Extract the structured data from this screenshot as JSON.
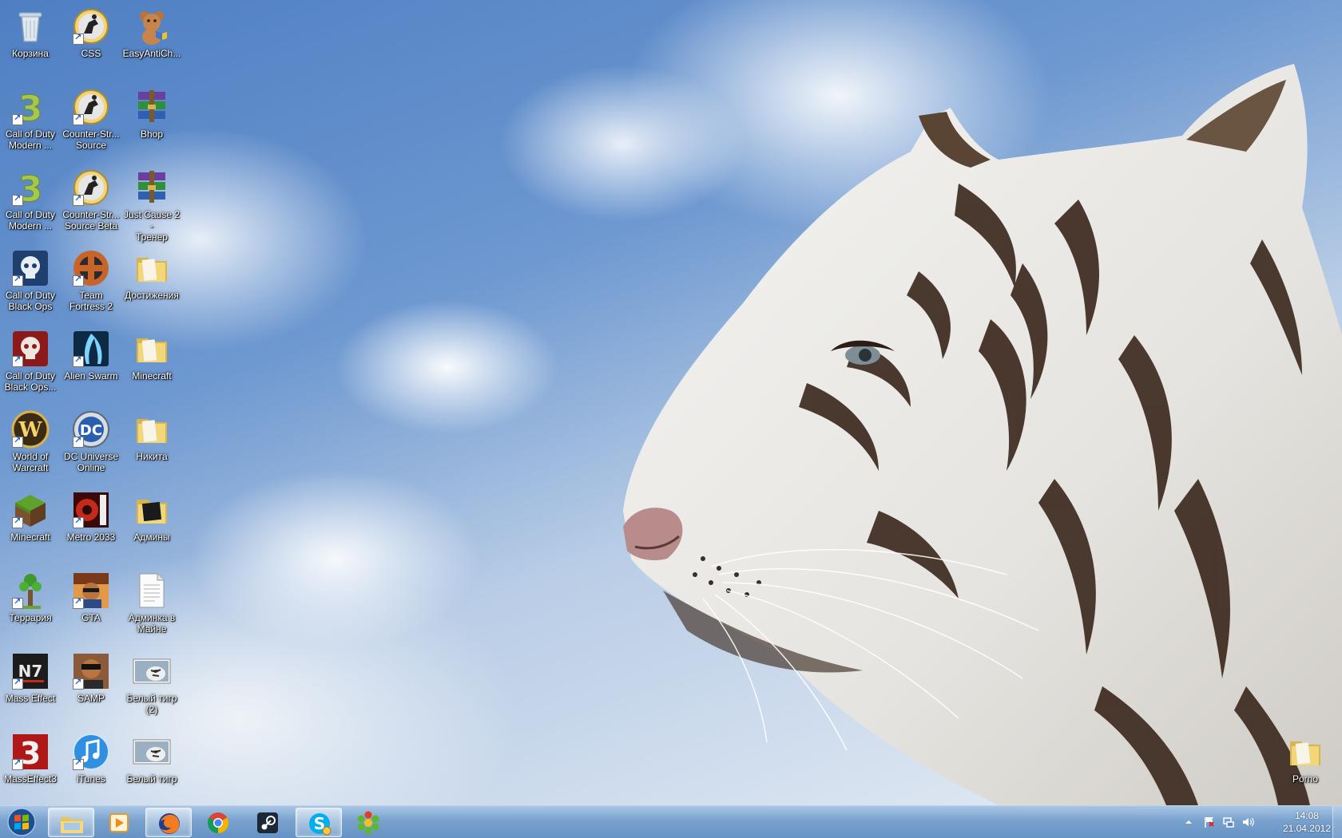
{
  "desktop": {
    "icons": [
      {
        "label": "Корзина",
        "icon": "recycle-bin-icon"
      },
      {
        "label": "CSS",
        "icon": "counter-strike-icon"
      },
      {
        "label": "EasyAntiCh...",
        "icon": "teddy-bear-icon"
      },
      {
        "label": "Call of Duty\nModern ...",
        "icon": "mw3-icon"
      },
      {
        "label": "Counter-Str...\nSource",
        "icon": "counter-strike-icon"
      },
      {
        "label": "Bhop",
        "icon": "winrar-icon"
      },
      {
        "label": "Call of Duty\nModern ...",
        "icon": "mw3-icon"
      },
      {
        "label": "Counter-Str...\nSource Beta",
        "icon": "counter-strike-icon"
      },
      {
        "label": "Just Cause 2 -\nТренер",
        "icon": "winrar-icon"
      },
      {
        "label": "Call of Duty\nBlack Ops",
        "icon": "black-ops-icon"
      },
      {
        "label": "Team\nFortress 2",
        "icon": "tf2-icon"
      },
      {
        "label": "Достижения",
        "icon": "folder-icon"
      },
      {
        "label": "Call of Duty\nBlack Ops...",
        "icon": "black-ops-red-icon"
      },
      {
        "label": "Alien Swarm",
        "icon": "alien-swarm-icon"
      },
      {
        "label": "Minecraft",
        "icon": "folder-icon"
      },
      {
        "label": "World of\nWarcraft",
        "icon": "wow-icon"
      },
      {
        "label": "DC Universe\nOnline",
        "icon": "dc-icon"
      },
      {
        "label": "Никита",
        "icon": "folder-icon"
      },
      {
        "label": "Minecraft",
        "icon": "minecraft-grass-icon"
      },
      {
        "label": "Metro 2033",
        "icon": "metro-icon"
      },
      {
        "label": "Админы",
        "icon": "folder-dark-icon"
      },
      {
        "label": "Террария",
        "icon": "terraria-tree-icon"
      },
      {
        "label": "GTA",
        "icon": "gta-icon"
      },
      {
        "label": "Админка в\nМайне",
        "icon": "text-document-icon"
      },
      {
        "label": "Mass Effect",
        "icon": "n7-icon"
      },
      {
        "label": "SAMP",
        "icon": "samp-icon"
      },
      {
        "label": "Белый тигр\n(2)",
        "icon": "image-thumbnail-icon"
      },
      {
        "label": "MassEffect3",
        "icon": "me3-icon"
      },
      {
        "label": "iTunes",
        "icon": "itunes-icon"
      },
      {
        "label": "Белый тигр",
        "icon": "image-thumbnail-icon"
      },
      {
        "label": "Porno",
        "icon": "folder-icon"
      }
    ]
  },
  "taskbar": {
    "start_icon": "windows-start-orb-icon",
    "pinned": [
      {
        "name": "explorer",
        "icon": "folder-icon",
        "active": true
      },
      {
        "name": "media-player",
        "icon": "media-player-icon",
        "active": false
      },
      {
        "name": "firefox",
        "icon": "firefox-icon",
        "active": true
      },
      {
        "name": "chrome",
        "icon": "chrome-icon",
        "active": false
      },
      {
        "name": "steam",
        "icon": "steam-icon",
        "active": false
      },
      {
        "name": "skype",
        "icon": "skype-icon",
        "active": true
      },
      {
        "name": "icq",
        "icon": "icq-flower-icon",
        "active": false
      }
    ],
    "tray": {
      "time": "14:08",
      "date": "21.04.2012"
    }
  },
  "colors": {
    "taskbar": "#7aa2d0",
    "icon_text": "#ffffff"
  }
}
